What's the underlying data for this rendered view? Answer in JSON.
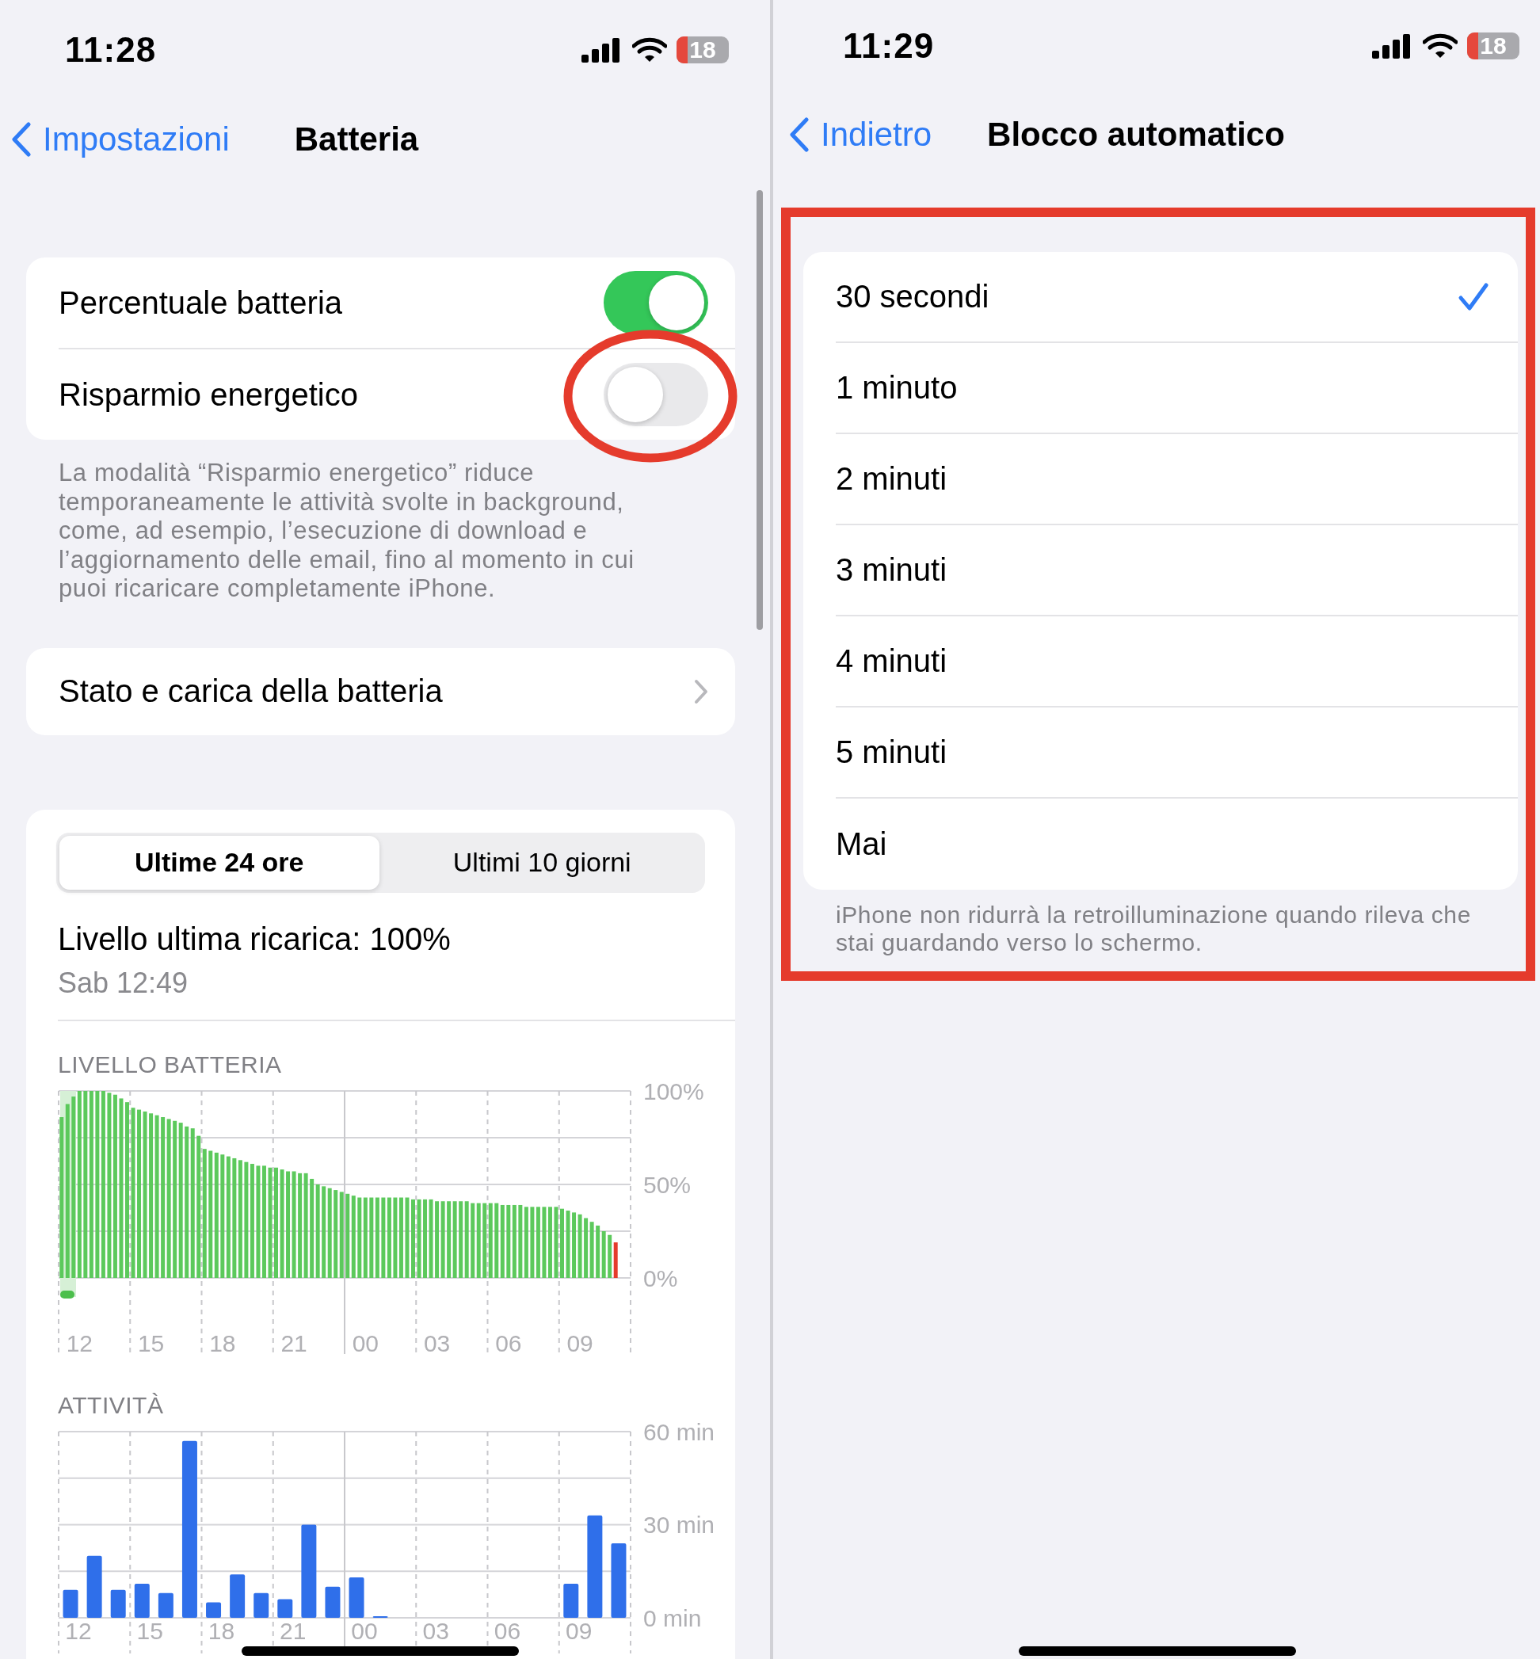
{
  "left_screen": {
    "status_bar": {
      "time": "11:28",
      "battery": "18"
    },
    "nav": {
      "back": "Impostazioni",
      "title": "Batteria"
    },
    "settings": [
      {
        "kind": "toggle",
        "label": "Percentuale batteria",
        "on": true,
        "highlighted": false
      },
      {
        "kind": "toggle",
        "label": "Risparmio energetico",
        "on": false,
        "highlighted": true
      }
    ],
    "settings_footer": "La modalità “Risparmio energetico” riduce temporaneamente le attività svolte in background, come, ad esempio, l’esecuzione di download e l’aggiornamento delle email, fino al momento in cui puoi ricaricare completamente iPhone.",
    "links": [
      {
        "label": "Stato e carica della batteria"
      }
    ],
    "usage": {
      "tabs": [
        {
          "label": "Ultime 24 ore",
          "selected": true
        },
        {
          "label": "Ultimi 10 giorni",
          "selected": false
        }
      ],
      "last_charge": "Livello ultima ricarica: 100%",
      "last_charge_time": "Sab 12:49",
      "battery_chart": {
        "chart_data": {
          "type": "bar",
          "title": "LIVELLO BATTERIA",
          "ylim": [
            0,
            100
          ],
          "yticks": [
            {
              "value": 0,
              "label": "0%"
            },
            {
              "value": 50,
              "label": "50%"
            },
            {
              "value": 100,
              "label": "100%"
            }
          ],
          "categories": [
            null,
            null,
            null,
            "12",
            null,
            null,
            null,
            null,
            null,
            null,
            null,
            null,
            null,
            null,
            null,
            "15",
            null,
            null,
            null,
            null,
            null,
            null,
            null,
            null,
            null,
            null,
            null,
            "18",
            null,
            null,
            null,
            null,
            null,
            null,
            null,
            null,
            null,
            null,
            null,
            "21",
            null,
            null,
            null,
            null,
            null,
            null,
            null,
            null,
            null,
            null,
            null,
            "00",
            null,
            null,
            null,
            null,
            null,
            null,
            null,
            null,
            null,
            null,
            null,
            "03",
            null,
            null,
            null,
            null,
            null,
            null,
            null,
            null,
            null,
            null,
            null,
            "06",
            null,
            null,
            null,
            null,
            null,
            null,
            null,
            null,
            null,
            null,
            null,
            "09",
            null,
            null,
            null,
            null,
            null,
            null,
            null,
            null
          ],
          "grid": true,
          "series": [
            {
              "color": "#5cc95c",
              "values": [
                86,
                93,
                97,
                100,
                100,
                100,
                100,
                100,
                99,
                98,
                96,
                94,
                91,
                90,
                89,
                88,
                87,
                86,
                85,
                84,
                83,
                81,
                80,
                76,
                69,
                68,
                67,
                66,
                65,
                64,
                63,
                62,
                61,
                60,
                60,
                59,
                59,
                58,
                57,
                57,
                56,
                56,
                53,
                50,
                49,
                48,
                47,
                46,
                45,
                44,
                43,
                43,
                43,
                43,
                43,
                43,
                43,
                43,
                43,
                42,
                42,
                42,
                42,
                41,
                41,
                41,
                41,
                41,
                41,
                40,
                40,
                40,
                40,
                40,
                39,
                39,
                39,
                39,
                38,
                38,
                38,
                38,
                38,
                38,
                37,
                36,
                35,
                34,
                32,
                30,
                28,
                25,
                23,
                null,
                null,
                null
              ]
            },
            {
              "color": "#e53b2c",
              "values": [
                null,
                null,
                null,
                null,
                null,
                null,
                null,
                null,
                null,
                null,
                null,
                null,
                null,
                null,
                null,
                null,
                null,
                null,
                null,
                null,
                null,
                null,
                null,
                null,
                null,
                null,
                null,
                null,
                null,
                null,
                null,
                null,
                null,
                null,
                null,
                null,
                null,
                null,
                null,
                null,
                null,
                null,
                null,
                null,
                null,
                null,
                null,
                null,
                null,
                null,
                null,
                null,
                null,
                null,
                null,
                null,
                null,
                null,
                null,
                null,
                null,
                null,
                null,
                null,
                null,
                null,
                null,
                null,
                null,
                null,
                null,
                null,
                null,
                null,
                null,
                null,
                null,
                null,
                null,
                null,
                null,
                null,
                null,
                null,
                null,
                null,
                null,
                null,
                null,
                null,
                null,
                null,
                null,
                19,
                null,
                null
              ]
            }
          ]
        }
      },
      "activity_chart": {
        "chart_data": {
          "type": "bar",
          "title": "ATTIVITÀ",
          "ylim": [
            0,
            60
          ],
          "yticks": [
            {
              "value": 0,
              "label": "0 min"
            },
            {
              "value": 30,
              "label": "30 min"
            },
            {
              "value": 60,
              "label": "60 min"
            }
          ],
          "categories": [
            "12",
            null,
            null,
            "15",
            null,
            null,
            "18",
            null,
            null,
            "21",
            null,
            null,
            "00",
            null,
            null,
            "03",
            null,
            null,
            "06",
            null,
            null,
            "09",
            null,
            null
          ],
          "grid": true,
          "series": [
            {
              "color": "#2f6fea",
              "values": [
                9,
                20,
                9,
                11,
                8,
                57,
                5,
                14,
                8,
                6,
                30,
                10,
                13,
                0.5,
                0,
                0,
                0,
                0,
                0,
                0,
                0,
                11,
                33,
                24
              ]
            }
          ]
        }
      }
    }
  },
  "right_screen": {
    "status_bar": {
      "time": "11:29",
      "battery": "18"
    },
    "nav": {
      "back": "Indietro",
      "title": "Blocco automatico"
    },
    "lock_section": {
      "highlighted": true,
      "options": [
        {
          "label": "30 secondi",
          "selected": true
        },
        {
          "label": "1 minuto",
          "selected": false
        },
        {
          "label": "2 minuti",
          "selected": false
        },
        {
          "label": "3 minuti",
          "selected": false
        },
        {
          "label": "4 minuti",
          "selected": false
        },
        {
          "label": "5 minuti",
          "selected": false
        },
        {
          "label": "Mai",
          "selected": false
        }
      ],
      "footer": "iPhone non ridurrà la retroilluminazione quando rileva che stai guardando verso lo schermo."
    }
  }
}
